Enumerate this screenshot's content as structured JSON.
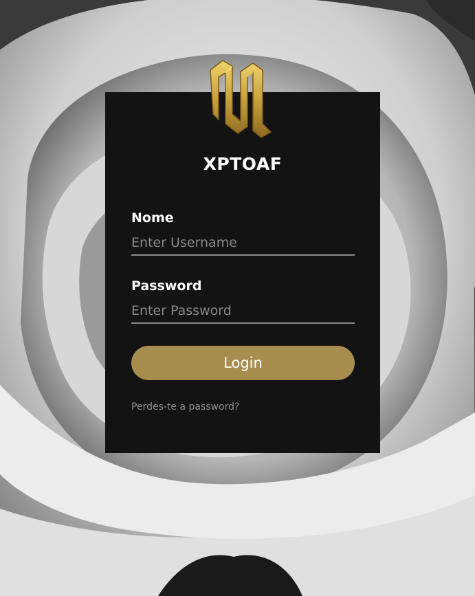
{
  "brand": {
    "name": "XPTOAF",
    "accent_color": "#a88e4e",
    "logo_icon": "gothic-monogram-icon"
  },
  "form": {
    "username_label": "Nome",
    "username_placeholder": "Enter Username",
    "password_label": "Password",
    "password_placeholder": "Enter Password",
    "login_label": "Login",
    "forgot_password": "Perdes-te a password?"
  },
  "background": {
    "subject": "rose-icon"
  }
}
